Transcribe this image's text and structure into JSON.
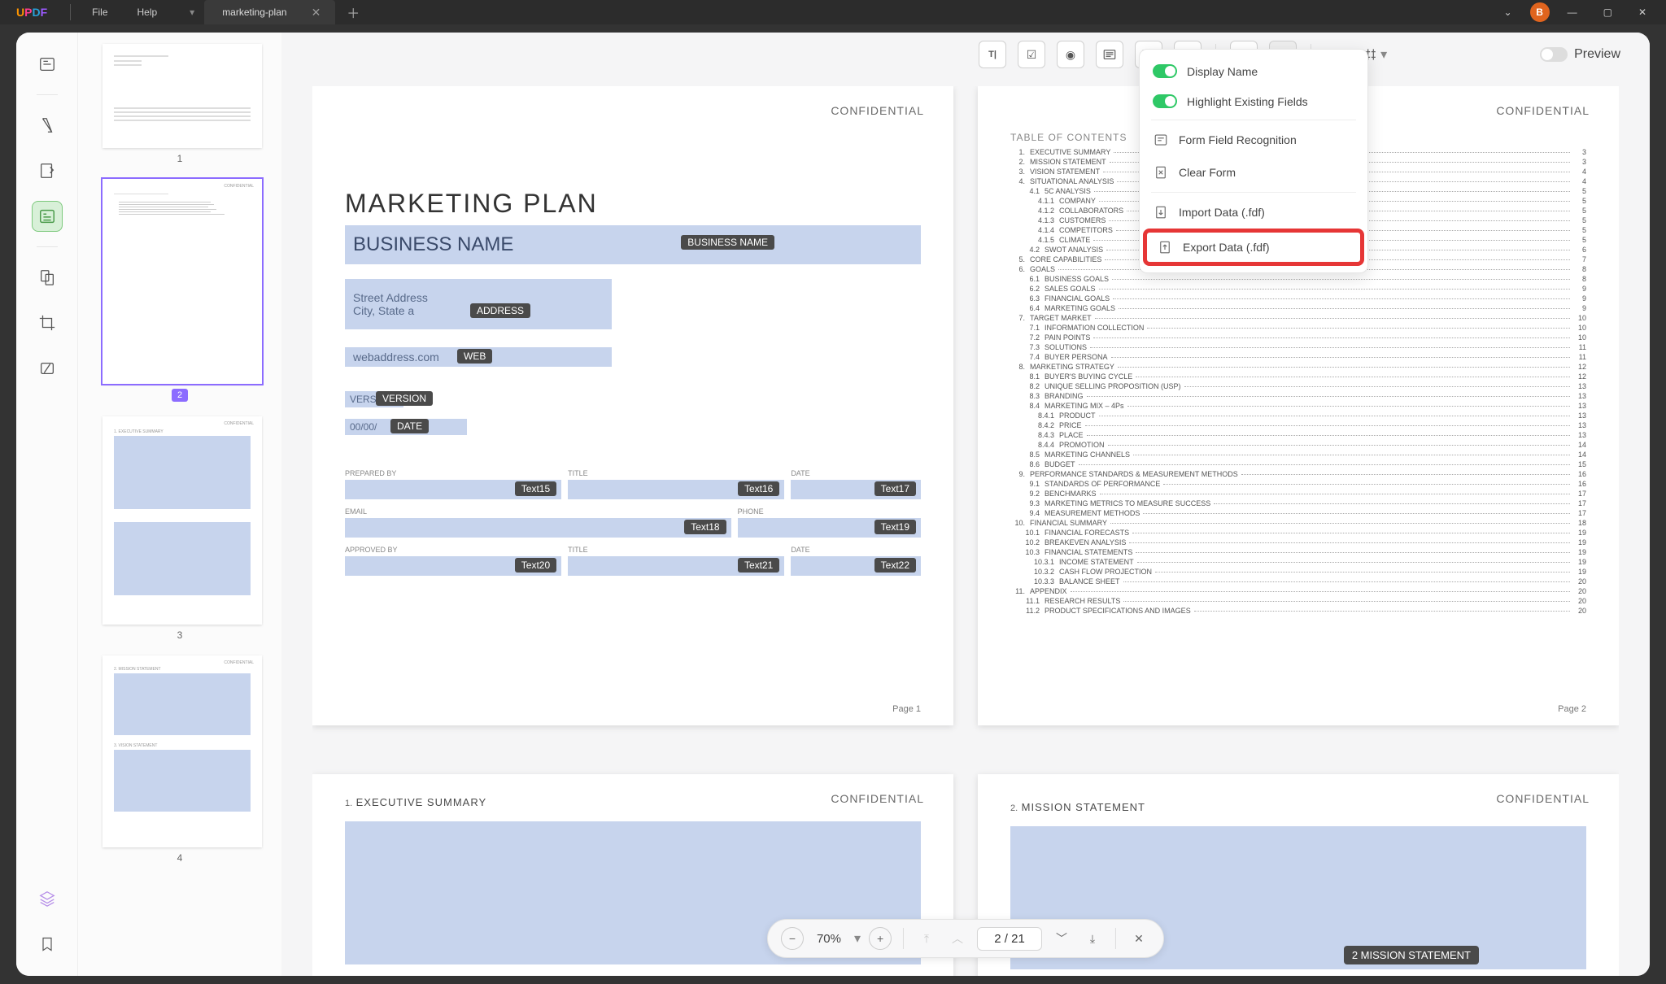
{
  "app": {
    "logo_text": "UPDF",
    "menus": [
      "File",
      "Help"
    ],
    "tab_title": "marketing-plan",
    "avatar": "B"
  },
  "thumbs": {
    "nums": [
      "1",
      "2",
      "3",
      "4"
    ],
    "selected_badge": "2"
  },
  "toolbar": {
    "preview": "Preview"
  },
  "page1": {
    "confidential": "CONFIDENTIAL",
    "title": "MARKETING PLAN",
    "business_value": "BUSINESS NAME",
    "business_tag": "BUSINESS NAME",
    "addr_l1": "Street Address",
    "addr_l2": "City, State a",
    "addr_tag": "ADDRESS",
    "web_value": "webaddress.com",
    "web_tag": "WEB",
    "vers_value": "VERS",
    "vers_tag": "VERSION",
    "date_value": "00/00/",
    "date_tag": "DATE",
    "cols1": [
      "PREPARED BY",
      "TITLE",
      "DATE"
    ],
    "tags1": [
      "Text15",
      "Text16",
      "Text17"
    ],
    "cols2": [
      "EMAIL",
      "PHONE"
    ],
    "tags2": [
      "Text18",
      "Text19"
    ],
    "cols3": [
      "APPROVED BY",
      "TITLE",
      "DATE"
    ],
    "tags3": [
      "Text20",
      "Text21",
      "Text22"
    ],
    "pagenum": "Page 1"
  },
  "page2": {
    "confidential": "CONFIDENTIAL",
    "toc_header": "TABLE OF CONTENTS",
    "toc": [
      {
        "n": "1.",
        "t": "EXECUTIVE SUMMARY",
        "p": "3"
      },
      {
        "n": "2.",
        "t": "MISSION STATEMENT",
        "p": "3"
      },
      {
        "n": "3.",
        "t": "VISION STATEMENT",
        "p": "4"
      },
      {
        "n": "4.",
        "t": "SITUATIONAL ANALYSIS",
        "p": "4"
      },
      {
        "n": "4.1",
        "t": "5C ANALYSIS",
        "p": "5",
        "sub": true
      },
      {
        "n": "4.1.1",
        "t": "COMPANY",
        "p": "5",
        "sub2": true
      },
      {
        "n": "4.1.2",
        "t": "COLLABORATORS",
        "p": "5",
        "sub2": true
      },
      {
        "n": "4.1.3",
        "t": "CUSTOMERS",
        "p": "5",
        "sub2": true
      },
      {
        "n": "4.1.4",
        "t": "COMPETITORS",
        "p": "5",
        "sub2": true
      },
      {
        "n": "4.1.5",
        "t": "CLIMATE",
        "p": "5",
        "sub2": true
      },
      {
        "n": "4.2",
        "t": "SWOT ANALYSIS",
        "p": "6",
        "sub": true
      },
      {
        "n": "5.",
        "t": "CORE CAPABILITIES",
        "p": "7"
      },
      {
        "n": "6.",
        "t": "GOALS",
        "p": "8"
      },
      {
        "n": "6.1",
        "t": "BUSINESS GOALS",
        "p": "8",
        "sub": true
      },
      {
        "n": "6.2",
        "t": "SALES GOALS",
        "p": "9",
        "sub": true
      },
      {
        "n": "6.3",
        "t": "FINANCIAL GOALS",
        "p": "9",
        "sub": true
      },
      {
        "n": "6.4",
        "t": "MARKETING GOALS",
        "p": "9",
        "sub": true
      },
      {
        "n": "7.",
        "t": "TARGET MARKET",
        "p": "10"
      },
      {
        "n": "7.1",
        "t": "INFORMATION COLLECTION",
        "p": "10",
        "sub": true
      },
      {
        "n": "7.2",
        "t": "PAIN POINTS",
        "p": "10",
        "sub": true
      },
      {
        "n": "7.3",
        "t": "SOLUTIONS",
        "p": "11",
        "sub": true
      },
      {
        "n": "7.4",
        "t": "BUYER PERSONA",
        "p": "11",
        "sub": true
      },
      {
        "n": "8.",
        "t": "MARKETING STRATEGY",
        "p": "12"
      },
      {
        "n": "8.1",
        "t": "BUYER'S BUYING CYCLE",
        "p": "12",
        "sub": true
      },
      {
        "n": "8.2",
        "t": "UNIQUE SELLING PROPOSITION (USP)",
        "p": "13",
        "sub": true
      },
      {
        "n": "8.3",
        "t": "BRANDING",
        "p": "13",
        "sub": true
      },
      {
        "n": "8.4",
        "t": "MARKETING MIX – 4Ps",
        "p": "13",
        "sub": true
      },
      {
        "n": "8.4.1",
        "t": "PRODUCT",
        "p": "13",
        "sub2": true
      },
      {
        "n": "8.4.2",
        "t": "PRICE",
        "p": "13",
        "sub2": true
      },
      {
        "n": "8.4.3",
        "t": "PLACE",
        "p": "13",
        "sub2": true
      },
      {
        "n": "8.4.4",
        "t": "PROMOTION",
        "p": "14",
        "sub2": true
      },
      {
        "n": "8.5",
        "t": "MARKETING CHANNELS",
        "p": "14",
        "sub": true
      },
      {
        "n": "8.6",
        "t": "BUDGET",
        "p": "15",
        "sub": true
      },
      {
        "n": "9.",
        "t": "PERFORMANCE STANDARDS & MEASUREMENT METHODS",
        "p": "16"
      },
      {
        "n": "9.1",
        "t": "STANDARDS OF PERFORMANCE",
        "p": "16",
        "sub": true
      },
      {
        "n": "9.2",
        "t": "BENCHMARKS",
        "p": "17",
        "sub": true
      },
      {
        "n": "9.3",
        "t": "MARKETING METRICS TO MEASURE SUCCESS",
        "p": "17",
        "sub": true
      },
      {
        "n": "9.4",
        "t": "MEASUREMENT METHODS",
        "p": "17",
        "sub": true
      },
      {
        "n": "10.",
        "t": "FINANCIAL SUMMARY",
        "p": "18"
      },
      {
        "n": "10.1",
        "t": "FINANCIAL FORECASTS",
        "p": "19",
        "sub": true
      },
      {
        "n": "10.2",
        "t": "BREAKEVEN ANALYSIS",
        "p": "19",
        "sub": true
      },
      {
        "n": "10.3",
        "t": "FINANCIAL STATEMENTS",
        "p": "19",
        "sub": true
      },
      {
        "n": "10.3.1",
        "t": "INCOME STATEMENT",
        "p": "19",
        "sub2": true
      },
      {
        "n": "10.3.2",
        "t": "CASH FLOW PROJECTION",
        "p": "19",
        "sub2": true
      },
      {
        "n": "10.3.3",
        "t": "BALANCE SHEET",
        "p": "20",
        "sub2": true
      },
      {
        "n": "11.",
        "t": "APPENDIX",
        "p": "20"
      },
      {
        "n": "11.1",
        "t": "RESEARCH RESULTS",
        "p": "20",
        "sub": true
      },
      {
        "n": "11.2",
        "t": "PRODUCT SPECIFICATIONS AND IMAGES",
        "p": "20",
        "sub": true
      }
    ],
    "pagenum": "Page 2"
  },
  "page3": {
    "confidential": "CONFIDENTIAL",
    "num": "1.",
    "title": "EXECUTIVE SUMMARY"
  },
  "page4": {
    "confidential": "CONFIDENTIAL",
    "num": "2.",
    "title": "MISSION STATEMENT",
    "float": "2 MISSION STATEMENT"
  },
  "dropdown": {
    "display_name": "Display Name",
    "highlight": "Highlight Existing Fields",
    "recognition": "Form Field Recognition",
    "clear": "Clear Form",
    "import": "Import Data (.fdf)",
    "export": "Export Data (.fdf)"
  },
  "pgbar": {
    "zoom": "70%",
    "page_input": "2  /  21"
  }
}
